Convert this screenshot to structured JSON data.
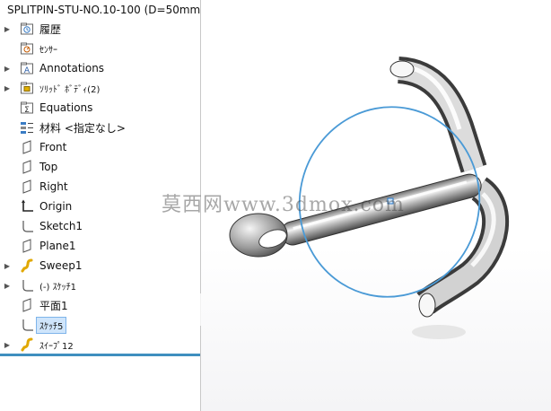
{
  "tree": {
    "root_label": "SPLITPIN-STU-NO.10-100  (D=50mm<",
    "items": [
      {
        "label": "履歴",
        "expandable": true
      },
      {
        "label": "ｾﾝｻｰ",
        "expandable": false
      },
      {
        "label": "Annotations",
        "expandable": true
      },
      {
        "label": "ｿﾘｯﾄﾞ ﾎﾞﾃﾞｨ(2)",
        "expandable": true
      },
      {
        "label": "Equations",
        "expandable": false
      },
      {
        "label": "材料 <指定なし>",
        "expandable": false
      },
      {
        "label": "Front",
        "expandable": false
      },
      {
        "label": "Top",
        "expandable": false
      },
      {
        "label": "Right",
        "expandable": false
      },
      {
        "label": "Origin",
        "expandable": false
      },
      {
        "label": "Sketch1",
        "expandable": false
      },
      {
        "label": "Plane1",
        "expandable": false
      },
      {
        "label": "Sweep1",
        "expandable": true
      },
      {
        "label": "(-) ｽｹｯﾁ1",
        "expandable": true
      },
      {
        "label": "平面1",
        "expandable": false
      },
      {
        "label": "ｽｹｯﾁ5",
        "expandable": false,
        "selected": true
      },
      {
        "label": "ｽｲｰﾌﾟ12",
        "expandable": true
      }
    ]
  },
  "viewport": {
    "watermark": "莫西网www.3dmox.com",
    "accent_color": "#4a9ad6"
  }
}
